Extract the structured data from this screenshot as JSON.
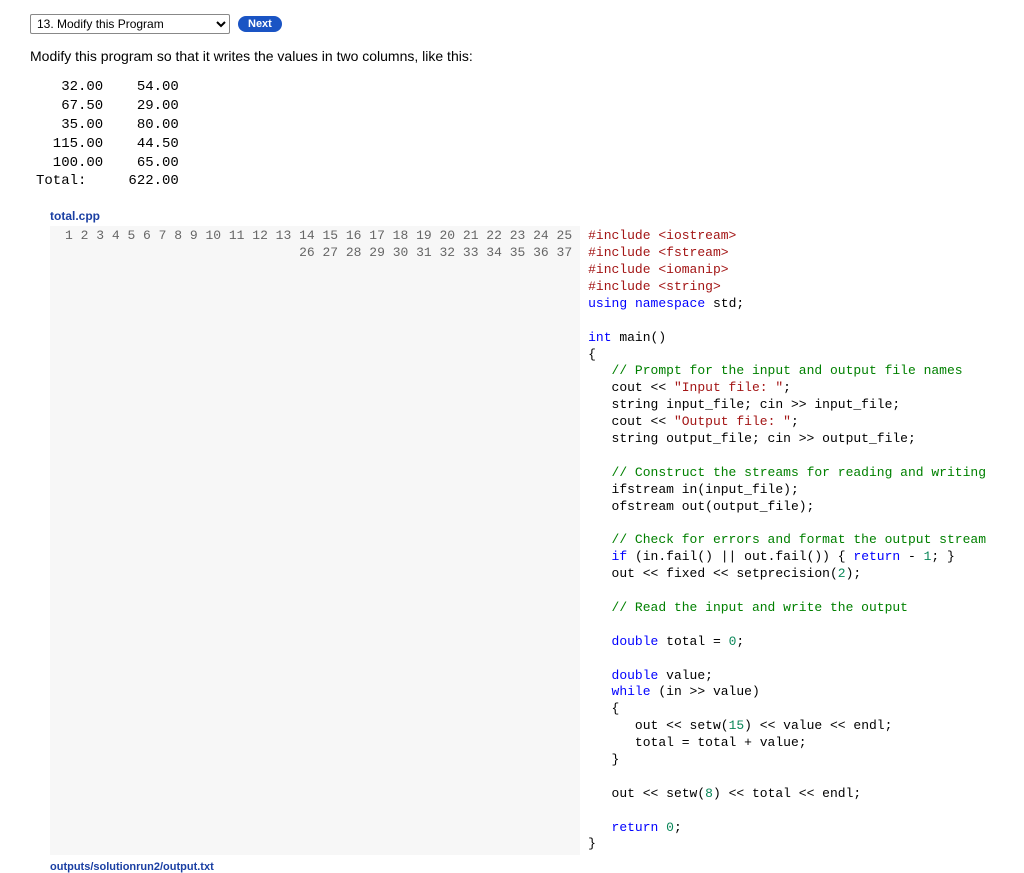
{
  "topbar": {
    "dropdown": "13. Modify this Program",
    "next_label": "Next"
  },
  "prompt": "Modify this program so that it writes the values in two columns, like this:",
  "example_output": "   32.00    54.00\n   67.50    29.00\n   35.00    80.00\n  115.00    44.50\n  100.00    65.00\nTotal:     622.00",
  "filename": "total.cpp",
  "output_filename": "outputs/solutionrun2/output.txt",
  "code_lines": [
    [
      [
        "pre",
        "#include "
      ],
      [
        "inc",
        "<iostream>"
      ]
    ],
    [
      [
        "pre",
        "#include "
      ],
      [
        "inc",
        "<fstream>"
      ]
    ],
    [
      [
        "pre",
        "#include "
      ],
      [
        "inc",
        "<iomanip>"
      ]
    ],
    [
      [
        "pre",
        "#include "
      ],
      [
        "inc",
        "<string>"
      ]
    ],
    [
      [
        "kw",
        "using"
      ],
      [
        "p",
        " "
      ],
      [
        "kw",
        "namespace"
      ],
      [
        "p",
        " std;"
      ]
    ],
    [],
    [
      [
        "kw",
        "int"
      ],
      [
        "p",
        " main()"
      ]
    ],
    [
      [
        "p",
        "{"
      ]
    ],
    [
      [
        "p",
        "   "
      ],
      [
        "com",
        "// Prompt for the input and output file names"
      ]
    ],
    [
      [
        "p",
        "   cout << "
      ],
      [
        "str",
        "\"Input file: \""
      ],
      [
        "p",
        ";"
      ]
    ],
    [
      [
        "p",
        "   string input_file; cin >> input_file;"
      ]
    ],
    [
      [
        "p",
        "   cout << "
      ],
      [
        "str",
        "\"Output file: \""
      ],
      [
        "p",
        ";"
      ]
    ],
    [
      [
        "p",
        "   string output_file; cin >> output_file;"
      ]
    ],
    [],
    [
      [
        "p",
        "   "
      ],
      [
        "com",
        "// Construct the streams for reading and writing"
      ]
    ],
    [
      [
        "p",
        "   ifstream in(input_file);"
      ]
    ],
    [
      [
        "p",
        "   ofstream out(output_file);"
      ]
    ],
    [],
    [
      [
        "p",
        "   "
      ],
      [
        "com",
        "// Check for errors and format the output stream"
      ]
    ],
    [
      [
        "p",
        "   "
      ],
      [
        "kw",
        "if"
      ],
      [
        "p",
        " (in.fail() || out.fail()) { "
      ],
      [
        "kw",
        "return"
      ],
      [
        "p",
        " - "
      ],
      [
        "num",
        "1"
      ],
      [
        "p",
        "; }"
      ]
    ],
    [
      [
        "p",
        "   out << fixed << setprecision("
      ],
      [
        "num",
        "2"
      ],
      [
        "p",
        ");"
      ]
    ],
    [],
    [
      [
        "p",
        "   "
      ],
      [
        "com",
        "// Read the input and write the output"
      ]
    ],
    [],
    [
      [
        "p",
        "   "
      ],
      [
        "kw",
        "double"
      ],
      [
        "p",
        " total = "
      ],
      [
        "num",
        "0"
      ],
      [
        "p",
        ";"
      ]
    ],
    [],
    [
      [
        "p",
        "   "
      ],
      [
        "kw",
        "double"
      ],
      [
        "p",
        " value;"
      ]
    ],
    [
      [
        "p",
        "   "
      ],
      [
        "kw",
        "while"
      ],
      [
        "p",
        " (in >> value)"
      ]
    ],
    [
      [
        "p",
        "   {"
      ]
    ],
    [
      [
        "p",
        "      out << setw("
      ],
      [
        "num",
        "15"
      ],
      [
        "p",
        ") << value << endl;"
      ]
    ],
    [
      [
        "p",
        "      total = total + value;"
      ]
    ],
    [
      [
        "p",
        "   }"
      ]
    ],
    [],
    [
      [
        "p",
        "   out << setw("
      ],
      [
        "num",
        "8"
      ],
      [
        "p",
        ") << total << endl;"
      ]
    ],
    [],
    [
      [
        "p",
        "   "
      ],
      [
        "kw",
        "return"
      ],
      [
        "p",
        " "
      ],
      [
        "num",
        "0"
      ],
      [
        "p",
        ";"
      ]
    ],
    [
      [
        "p",
        "}"
      ]
    ]
  ]
}
